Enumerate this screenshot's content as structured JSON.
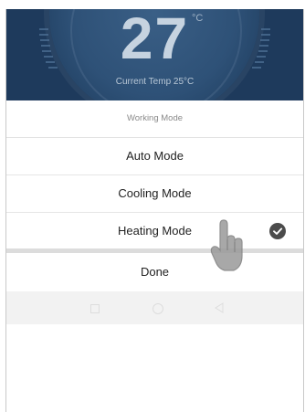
{
  "header": {
    "set_temperature": "27",
    "unit": "°C",
    "current_temp_label": "Current Temp 25°C"
  },
  "dialog": {
    "title": "Working Mode",
    "options": [
      {
        "label": "Auto Mode",
        "selected": false
      },
      {
        "label": "Cooling Mode",
        "selected": false
      },
      {
        "label": "Heating Mode",
        "selected": true
      }
    ],
    "done_label": "Done"
  },
  "icons": {
    "check": "check-circle-icon",
    "pointer": "hand-pointer-icon",
    "nav_recent": "square-icon",
    "nav_home": "circle-icon",
    "nav_back": "triangle-back-icon"
  },
  "colors": {
    "header_bg": "#1e3a5c",
    "check_bg": "#4b4b4b",
    "text": "#222222"
  }
}
